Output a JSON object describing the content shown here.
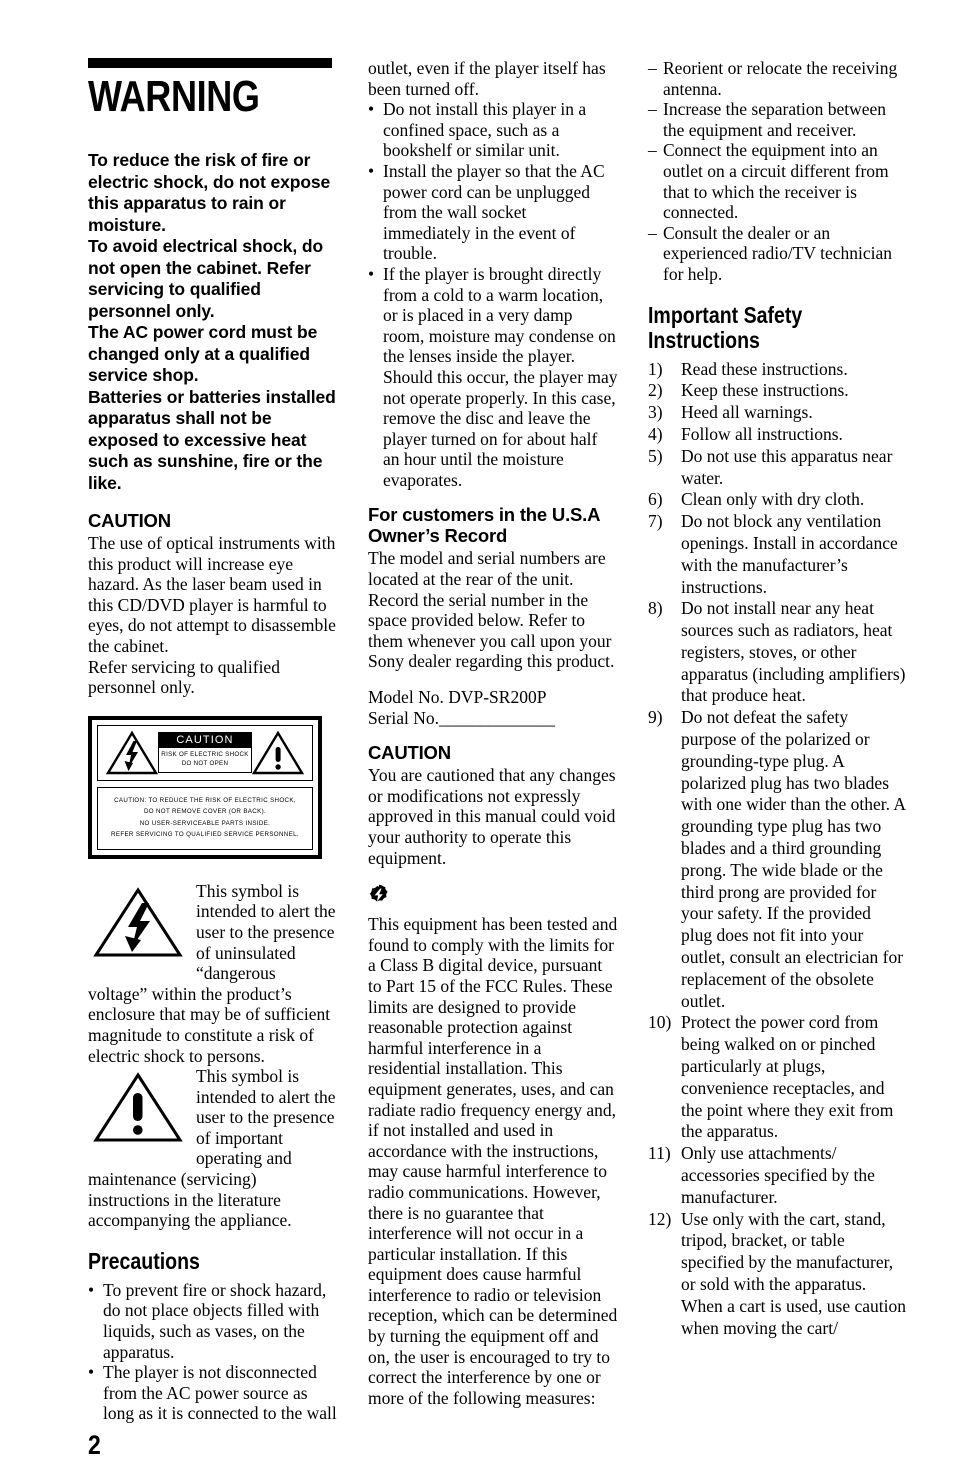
{
  "page": {
    "number": "2"
  },
  "col1": {
    "warning_heading": "WARNING",
    "bold_intro": [
      "To reduce the risk of fire or electric shock, do not expose this apparatus to rain or moisture.",
      "To avoid electrical shock, do not open the cabinet. Refer servicing to qualified personnel only.",
      "The AC power cord must be changed only at a qualified service shop.",
      "Batteries or batteries installed apparatus shall not be exposed to excessive heat such as sunshine, fire or the like."
    ],
    "caution_heading": "CAUTION",
    "caution_text_1": "The use of optical instruments with this product will increase eye hazard. As the laser beam used in this CD/DVD player is harmful to eyes, do not attempt to disassemble the cabinet.",
    "caution_text_2": "Refer servicing to qualified personnel only.",
    "label": {
      "banner_title": "CAUTION",
      "banner_line_1": "RISK OF ELECTRIC SHOCK",
      "banner_line_2": "DO NOT OPEN",
      "lines": [
        "CAUTION: TO REDUCE THE RISK OF ELECTRIC SHOCK,",
        "DO NOT REMOVE COVER (OR BACK).",
        "NO USER-SERVICEABLE PARTS INSIDE.",
        "REFER SERVICING TO QUALIFIED SERVICE PERSONNEL."
      ]
    },
    "symbol_bolt_text": "This symbol is intended to alert the user to the presence of uninsulated “dangerous voltage” within the product’s enclosure that may be of sufficient magnitude to constitute a risk of electric shock to persons.",
    "symbol_excl_text": "This symbol is intended to alert the user to the presence of important operating and maintenance (servicing) instructions in the literature accompanying the appliance.",
    "precautions_heading": "Precautions",
    "precautions": [
      "To prevent fire or shock hazard, do not place objects filled with liquids, such as vases, on the apparatus.",
      "The player is not disconnected from the AC power source as long as it is connected to the wall"
    ]
  },
  "col2": {
    "continued_text": "outlet, even if the player itself has been turned off.",
    "precautions_continued": [
      "Do not install this player in a confined space, such as a bookshelf or similar unit.",
      "Install the player so that the AC power cord can be unplugged from the wall socket immediately in the event of trouble.",
      "If the player is brought directly from a cold to a warm location, or is placed in a very damp room, moisture may condense on the lenses inside the player. Should this occur, the player may not operate properly. In this case, remove the disc and leave the player turned on for about half an hour until the moisture evaporates."
    ],
    "usa_heading_line1": "For customers in the U.S.A",
    "usa_heading_line2": "Owner’s Record",
    "usa_text": "The model and serial numbers are located at the rear of the unit. Record the serial number in the space provided below. Refer to them whenever you call upon your Sony dealer regarding this product.",
    "model_label": "Model No. DVP-SR200P",
    "serial_label": "Serial No.",
    "serial_blank": "______________",
    "caution_heading": "CAUTION",
    "caution_text": "You are cautioned that any changes or modifications not expressly approved in this manual could void your authority to operate this equipment.",
    "note_icon": "note-flash-icon",
    "fcc_text": "This equipment has been tested and found to comply with the limits for a Class B digital device, pursuant to Part 15 of the FCC Rules. These limits are designed to provide reasonable protection against harmful interference in a residential installation. This equipment generates, uses, and can radiate radio frequency energy and, if not installed and used in accordance with the instructions, may cause harmful interference to radio communications. However, there is no guarantee that interference will not occur in a particular installation. If this equipment does cause harmful interference to radio or television reception, which can be determined by turning the equipment off and on, the user is encouraged to try to correct the interference by one or more of the following measures:"
  },
  "col3": {
    "measures": [
      "Reorient or relocate the receiving antenna.",
      "Increase the separation between the equipment and receiver.",
      "Connect the equipment into an outlet on a circuit different from that to which the receiver is connected.",
      "Consult the dealer or an experienced radio/TV technician for help."
    ],
    "safety_heading_line1": "Important Safety",
    "safety_heading_line2": "Instructions",
    "safety_items": [
      {
        "num": "1)",
        "text": "Read these instructions."
      },
      {
        "num": "2)",
        "text": "Keep these instructions."
      },
      {
        "num": "3)",
        "text": "Heed all warnings."
      },
      {
        "num": "4)",
        "text": "Follow all instructions."
      },
      {
        "num": "5)",
        "text": "Do not use this apparatus near water."
      },
      {
        "num": "6)",
        "text": "Clean only with dry cloth."
      },
      {
        "num": "7)",
        "text": "Do not block any ventilation openings. Install in accordance with the manufacturer’s instructions."
      },
      {
        "num": "8)",
        "text": "Do not install near any heat sources such as radiators, heat registers, stoves, or other apparatus (including amplifiers) that produce heat."
      },
      {
        "num": "9)",
        "text": "Do not defeat the safety purpose of the polarized or grounding-type plug. A polarized plug has two blades with one wider than the other. A grounding type plug has two blades and a third grounding prong. The wide blade or the third prong are provided for your safety. If the provided plug does not fit into your outlet, consult an electrician for replacement of the obsolete outlet."
      },
      {
        "num": "10)",
        "text": "Protect the power cord from being walked on or pinched particularly at plugs, convenience receptacles, and the point where they exit from the apparatus."
      },
      {
        "num": "11)",
        "text": "Only use attachments/ accessories specified by the manufacturer."
      },
      {
        "num": "12)",
        "text": "Use only with the cart, stand, tripod, bracket, or table specified by the manufacturer, or sold with the apparatus. When a cart is used, use caution when moving the cart/"
      }
    ]
  },
  "markers": {
    "bullet": "•",
    "dash": "–"
  }
}
